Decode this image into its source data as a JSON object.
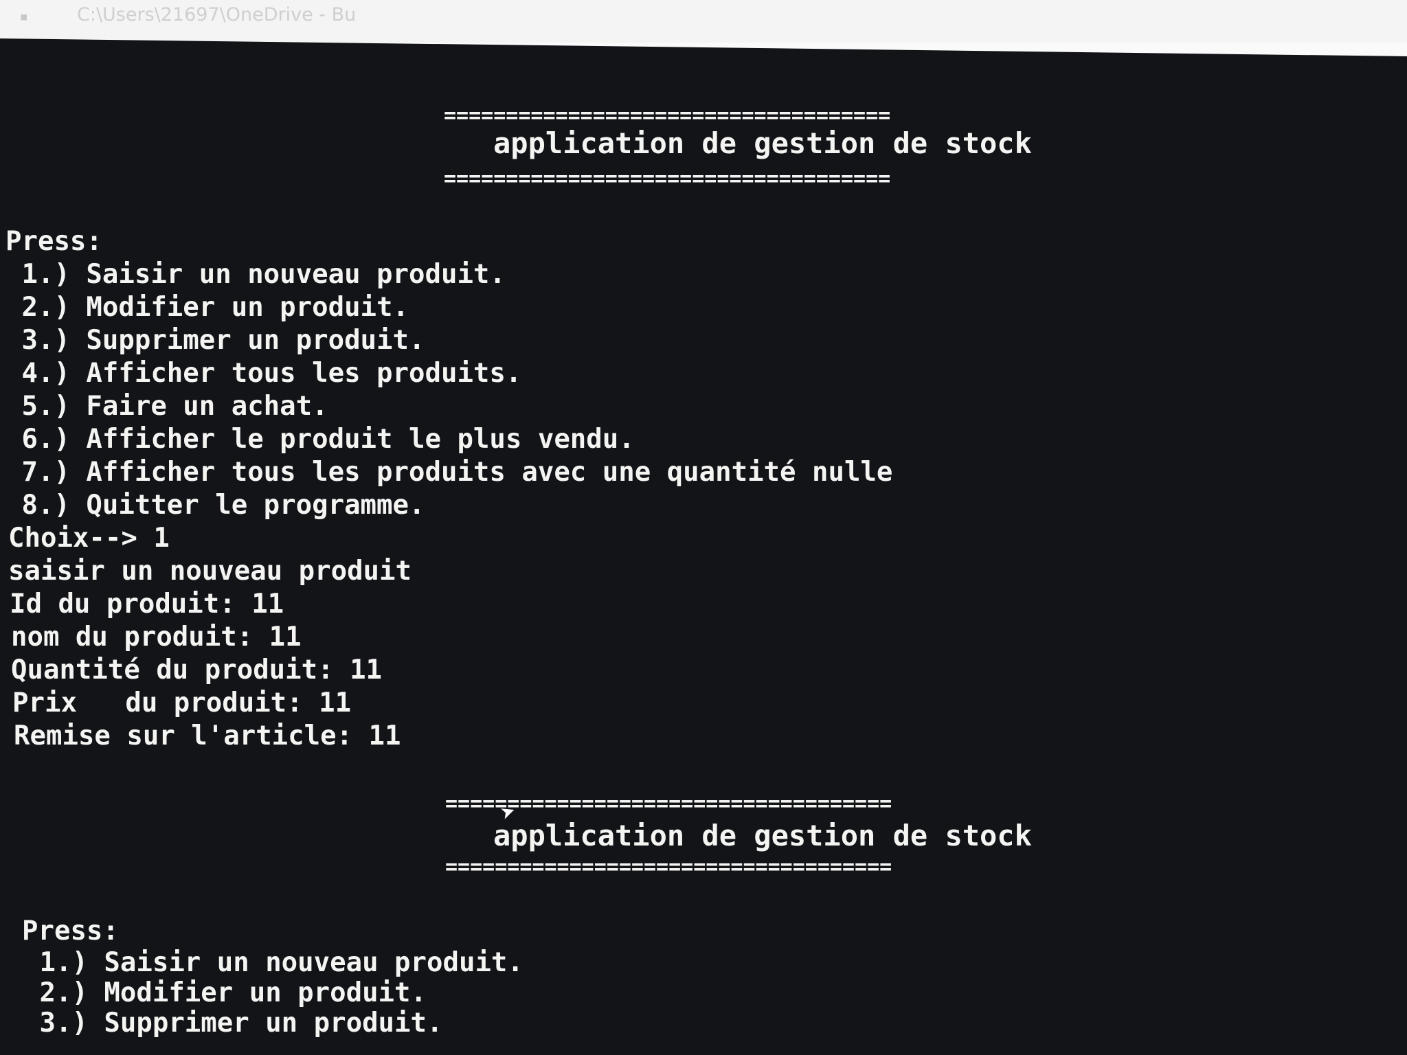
{
  "window": {
    "title_path": "C:\\Users\\21697\\OneDrive - Bu",
    "icon": "terminal-icon"
  },
  "banner": {
    "rule": "====================================",
    "title": "application de gestion de stock"
  },
  "menu": {
    "prompt": "Press:",
    "items": [
      " 1.) Saisir un nouveau produit.",
      " 2.) Modifier un produit.",
      " 3.) Supprimer un produit.",
      " 4.) Afficher tous les produits.",
      " 5.) Faire un achat.",
      " 6.) Afficher le produit le plus vendu.",
      " 7.) Afficher tous les produits avec une quantité nulle",
      " 8.) Quitter le programme."
    ]
  },
  "session": {
    "choice": "Choix--> 1",
    "heading": "saisir un nouveau produit",
    "fields": [
      "Id du produit: 11",
      "nom du produit: 11",
      "Quantité du produit: 11",
      "Prix   du produit: 11",
      "Remise sur l'article: 11"
    ]
  },
  "cursor": {
    "icon": "mouse-pointer-icon"
  },
  "colors": {
    "console_bg": "#121418",
    "console_text": "#f4f4f2"
  }
}
